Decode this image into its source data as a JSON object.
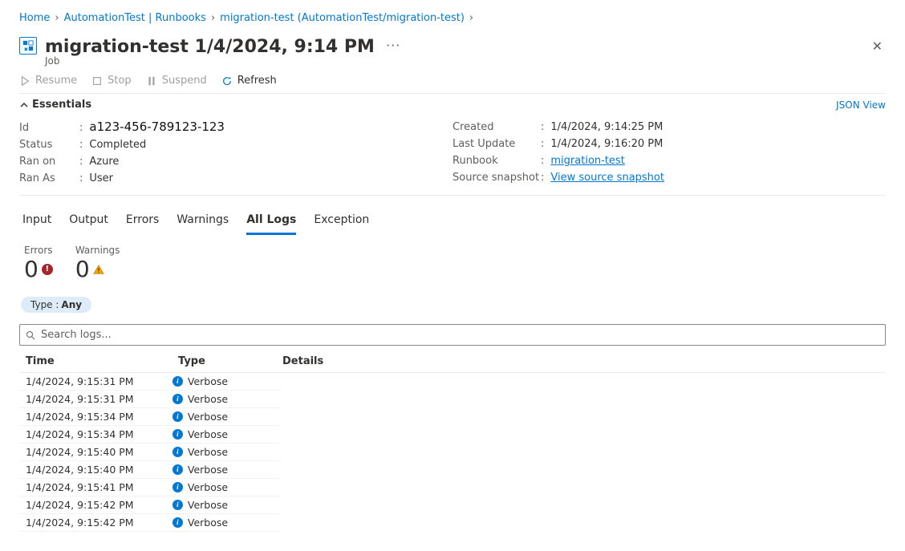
{
  "breadcrumb": [
    {
      "label": "Home"
    },
    {
      "label": "AutomationTest | Runbooks"
    },
    {
      "label": "migration-test (AutomationTest/migration-test)"
    }
  ],
  "header": {
    "title": "migration-test 1/4/2024, 9:14 PM",
    "subtitle": "Job"
  },
  "toolbar": {
    "resume": "Resume",
    "stop": "Stop",
    "suspend": "Suspend",
    "refresh": "Refresh"
  },
  "essentials": {
    "toggle_label": "Essentials",
    "json_view": "JSON View",
    "left": [
      {
        "key": "Id",
        "value": "a123-456-789123-123",
        "cls": "id"
      },
      {
        "key": "Status",
        "value": "Completed"
      },
      {
        "key": "Ran on",
        "value": "Azure"
      },
      {
        "key": "Ran As",
        "value": "User"
      }
    ],
    "right": [
      {
        "key": "Created",
        "value": "1/4/2024, 9:14:25 PM"
      },
      {
        "key": "Last Update",
        "value": "1/4/2024, 9:16:20 PM"
      },
      {
        "key": "Runbook",
        "value": "migration-test",
        "link": true
      },
      {
        "key": "Source snapshot",
        "value": "View source snapshot",
        "link": true
      }
    ]
  },
  "tabs": [
    {
      "label": "Input",
      "active": false
    },
    {
      "label": "Output",
      "active": false
    },
    {
      "label": "Errors",
      "active": false
    },
    {
      "label": "Warnings",
      "active": false
    },
    {
      "label": "All Logs",
      "active": true
    },
    {
      "label": "Exception",
      "active": false
    }
  ],
  "counters": {
    "errors_label": "Errors",
    "errors_value": "0",
    "warnings_label": "Warnings",
    "warnings_value": "0"
  },
  "filter": {
    "key": "Type : ",
    "value": "Any"
  },
  "search": {
    "placeholder": "Search logs..."
  },
  "table": {
    "headers": {
      "time": "Time",
      "type": "Type",
      "details": "Details"
    },
    "rows": [
      {
        "time": "1/4/2024, 9:15:31 PM",
        "type": "Verbose",
        "details": ""
      },
      {
        "time": "1/4/2024, 9:15:31 PM",
        "type": "Verbose",
        "details": ""
      },
      {
        "time": "1/4/2024, 9:15:34 PM",
        "type": "Verbose",
        "details": ""
      },
      {
        "time": "1/4/2024, 9:15:34 PM",
        "type": "Verbose",
        "details": ""
      },
      {
        "time": "1/4/2024, 9:15:40 PM",
        "type": "Verbose",
        "details": ""
      },
      {
        "time": "1/4/2024, 9:15:40 PM",
        "type": "Verbose",
        "details": ""
      },
      {
        "time": "1/4/2024, 9:15:41 PM",
        "type": "Verbose",
        "details": ""
      },
      {
        "time": "1/4/2024, 9:15:42 PM",
        "type": "Verbose",
        "details": ""
      },
      {
        "time": "1/4/2024, 9:15:42 PM",
        "type": "Verbose",
        "details": ""
      }
    ]
  },
  "icons": {
    "play": "play-icon",
    "stop": "stop-icon",
    "pause": "pause-icon",
    "refresh": "refresh-icon"
  }
}
